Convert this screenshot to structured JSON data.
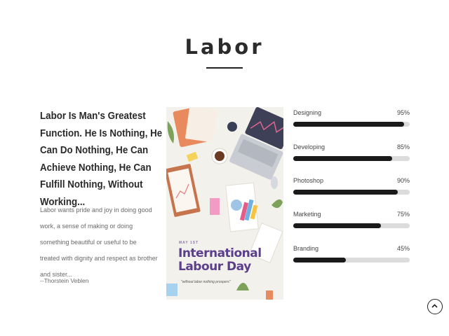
{
  "section": {
    "title": "Labor"
  },
  "quote": {
    "heading": "Labor Is Man's Greatest Function. He Is Nothing, He Can Do Nothing, He Can Achieve Nothing, He Can Fulfill Nothing, Without Working...",
    "body": "Labor wants pride and joy in doing good work, a sense of making or doing something beautiful or useful to be treated with dignity and respect as brother and sister...",
    "author": "--Thorstein Veblen"
  },
  "illustration": {
    "caption": "MAY 1ST",
    "title": "International Labour Day",
    "subtitle": "\"without labor nothing prospers\""
  },
  "skills": [
    {
      "name": "Designing",
      "percent_label": "95%",
      "value": 0.95
    },
    {
      "name": "Developing",
      "percent_label": "85%",
      "value": 0.85
    },
    {
      "name": "Photoshop",
      "percent_label": "90%",
      "value": 0.9
    },
    {
      "name": "Marketing",
      "percent_label": "75%",
      "value": 0.75
    },
    {
      "name": "Branding",
      "percent_label": "45%",
      "value": 0.45
    }
  ],
  "icons": {
    "scroll_top": "chevron-up-icon"
  },
  "colors": {
    "bar_fill": "#1a1a1a",
    "bar_track": "#dcdcdc",
    "illustration_title": "#5b3f8c"
  }
}
